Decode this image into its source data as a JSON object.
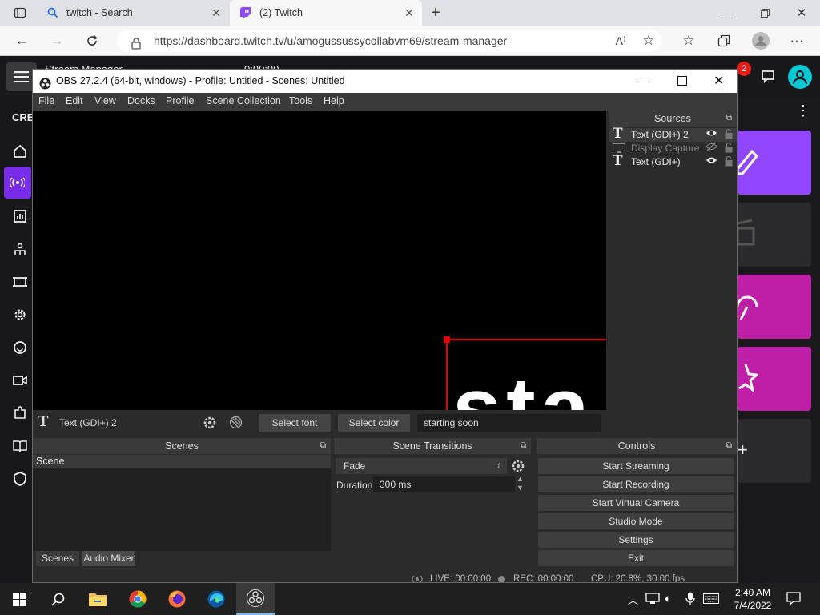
{
  "browser": {
    "tabs": [
      {
        "title": "twitch - Search"
      },
      {
        "title": "(2) Twitch"
      }
    ],
    "url": "https://dashboard.twitch.tv/u/amogussussycollabvm69/stream-manager",
    "reader_label": "A⁾"
  },
  "twitch": {
    "header_title": "Stream Manager",
    "header_timer": "0:00:00",
    "notification_count": "2",
    "sidebar_heading": "CRE"
  },
  "obs": {
    "title": "OBS 27.2.4 (64-bit, windows) - Profile: Untitled - Scenes: Untitled",
    "menu": [
      "File",
      "Edit",
      "View",
      "Docks",
      "Profile",
      "Scene Collection",
      "Tools",
      "Help"
    ],
    "preview_text": "sta",
    "sources": {
      "header": "Sources",
      "items": [
        {
          "name": "Text (GDI+) 2",
          "visible": true,
          "selected": true
        },
        {
          "name": "Display Capture",
          "visible": false,
          "selected": false
        },
        {
          "name": "Text (GDI+)",
          "visible": true,
          "selected": false
        }
      ]
    },
    "properties_bar": {
      "source_name": "Text (GDI+) 2",
      "select_font": "Select font",
      "select_color": "Select color",
      "text_value": "starting soon"
    },
    "scenes": {
      "header": "Scenes",
      "items": [
        "Scene"
      ],
      "tabs": [
        "Scenes",
        "Audio Mixer"
      ]
    },
    "transitions": {
      "header": "Scene Transitions",
      "selected": "Fade",
      "duration_label": "Duration",
      "duration_value": "300 ms"
    },
    "controls": {
      "header": "Controls",
      "buttons": [
        "Start Streaming",
        "Start Recording",
        "Start Virtual Camera",
        "Studio Mode",
        "Settings",
        "Exit"
      ]
    },
    "status": {
      "live": "LIVE: 00:00:00",
      "rec": "REC: 00:00:00",
      "cpu": "CPU: 20.8%, 30.00 fps"
    }
  },
  "taskbar": {
    "time": "2:40 AM",
    "date": "7/4/2022"
  },
  "colors": {
    "twitch_purple": "#9147ff",
    "twitch_magenta": "#bf1fa6",
    "obs_bg": "#2b2b2b",
    "selection_red": "#e00000"
  }
}
